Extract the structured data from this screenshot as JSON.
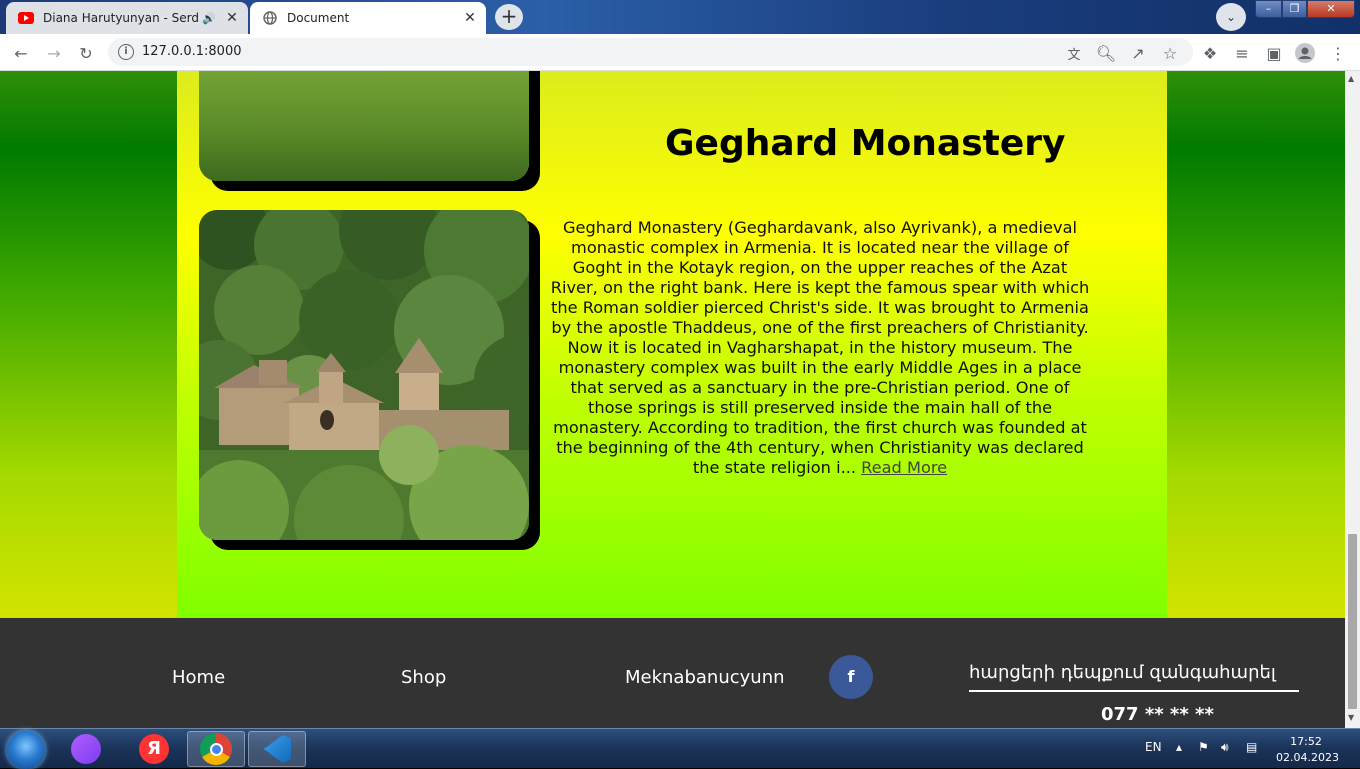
{
  "browser": {
    "tabs": [
      {
        "title": "Diana Harutyunyan - Serd Sa",
        "active": false,
        "audio": true
      },
      {
        "title": "Document",
        "active": true
      }
    ],
    "new_tab_label": "+",
    "url": "127.0.0.1:8000"
  },
  "page": {
    "heading": "Geghard Monastery",
    "description": "Geghard Monastery (Geghardavank, also Ayrivank), a medieval monastic complex in Armenia. It is located near the village of Goght in the Kotayk region, on the upper reaches of the Azat River, on the right bank. Here is kept the famous spear with which the Roman soldier pierced Christ's side. It was brought to Armenia by the apostle Thaddeus, one of the first preachers of Christianity. Now it is located in Vagharshapat, in the history museum. The monastery complex was built in the early Middle Ages in a place that served as a sanctuary in the pre-Christian period. One of those springs is still preserved inside the main hall of the monastery. According to tradition, the first church was founded at the beginning of the 4th century, when Christianity was declared the state religion i... ",
    "read_more": "Read More"
  },
  "footer": {
    "links": [
      "Home",
      "Shop",
      "Meknabanucyunn"
    ],
    "facebook_label": "f",
    "call_text": "հարցերի դեպքում զանգահարել",
    "phone": "077 ** ** **"
  },
  "taskbar": {
    "yandex_label": "Я",
    "language": "EN",
    "time": "17:52",
    "date": "02.04.2023"
  },
  "colors": {
    "footer_bg": "#333333",
    "facebook": "#3b5998",
    "content_top": "#dcec1c",
    "content_bottom": "#80ff00"
  },
  "icons": [
    "youtube-icon",
    "globe-icon",
    "back-icon",
    "forward-icon",
    "reload-icon",
    "info-icon",
    "translate-icon",
    "zoom-icon",
    "share-icon",
    "bookmark-star-icon",
    "extensions-icon",
    "reading-list-icon",
    "side-panel-icon",
    "profile-icon",
    "menu-icon",
    "facebook-icon",
    "windows-start-icon",
    "alice-icon",
    "yandex-icon",
    "chrome-icon",
    "vscode-icon"
  ]
}
